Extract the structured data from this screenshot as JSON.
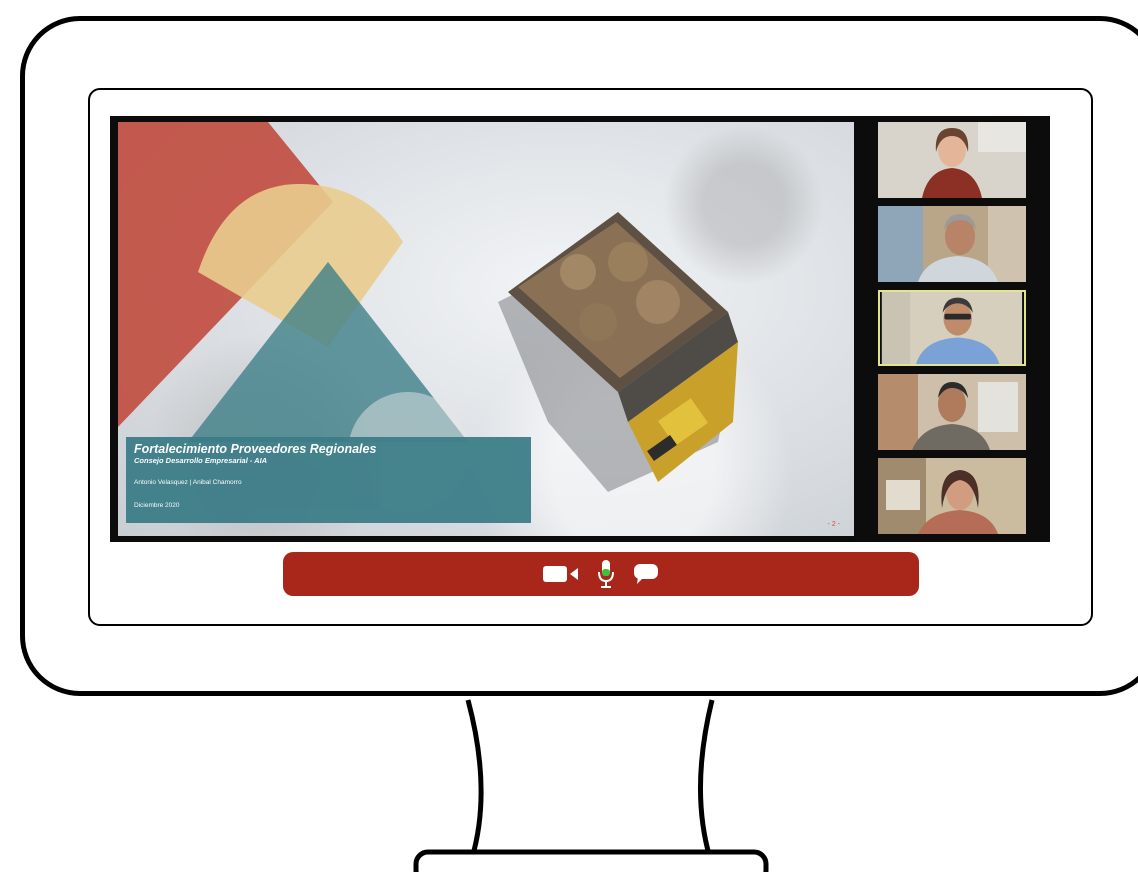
{
  "slide": {
    "title": "Fortalecimiento Proveedores Regionales",
    "subtitle": "Consejo Desarrollo Empresarial - AIA",
    "presenters": "Antonio Velasquez | Anibal Chamorro",
    "date": "Diciembre 2020",
    "page_number": "- 2 -"
  },
  "participants": [
    {
      "id": "participant-1",
      "active": false,
      "shirt": "#8c2f24",
      "bg": "#d8d4cc"
    },
    {
      "id": "participant-2",
      "active": false,
      "shirt": "#cfd6dc",
      "bg": "#b9a588"
    },
    {
      "id": "participant-3",
      "active": true,
      "shirt": "#7aa2d6",
      "bg": "#d7cfbd"
    },
    {
      "id": "participant-4",
      "active": false,
      "shirt": "#6f6a62",
      "bg": "#cdbfaa"
    },
    {
      "id": "participant-5",
      "active": false,
      "shirt": "#b56d58",
      "bg": "#cbbc9f"
    }
  ],
  "controls": {
    "camera_icon": "video-camera-icon",
    "mic_icon": "microphone-icon",
    "chat_icon": "chat-bubble-icon",
    "mic_active_color": "#3fbf3f",
    "bar_color": "#a8271a"
  }
}
